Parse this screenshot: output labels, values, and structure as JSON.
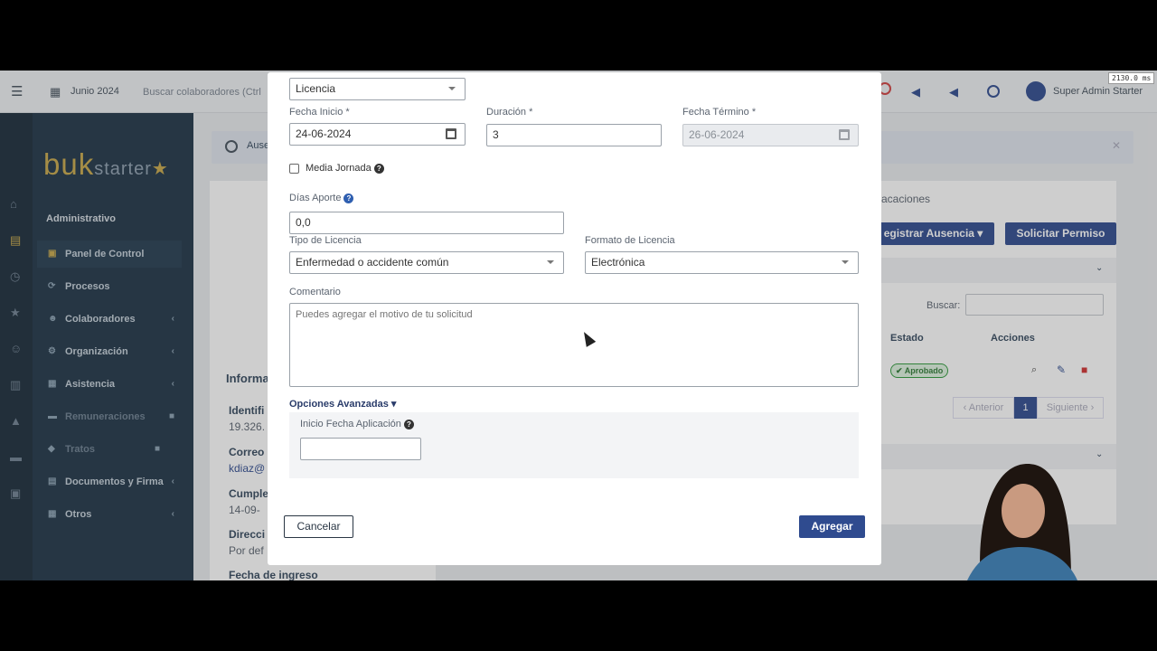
{
  "topbar": {
    "month": "Junio 2024",
    "search_placeholder": "Buscar colaboradores (Ctrl",
    "user": "Super Admin Starter",
    "timing": "2130.0 ms"
  },
  "sidebar": {
    "logo_main": "buk",
    "logo_sub": "starter",
    "section": "Administrativo",
    "items": [
      {
        "label": "Panel de Control"
      },
      {
        "label": "Procesos"
      },
      {
        "label": "Colaboradores"
      },
      {
        "label": "Organización"
      },
      {
        "label": "Asistencia"
      },
      {
        "label": "Remuneraciones"
      },
      {
        "label": "Tratos"
      },
      {
        "label": "Documentos y Firma"
      },
      {
        "label": "Otros"
      }
    ]
  },
  "background": {
    "alert_text": "Ause",
    "tab_label": "acaciones",
    "register_absence": "egistrar Ausencia",
    "request_permit": "Solicitar Permiso",
    "search_label": "Buscar:",
    "col_estado": "Estado",
    "col_acciones": "Acciones",
    "status_badge": "Aprobado",
    "prev": "Anterior",
    "page": "1",
    "next": "Siguiente",
    "info_title": "Informa",
    "ident_label": "Identifi",
    "ident_value": "19.326.",
    "email_label": "Correo",
    "email_value": "kdiaz@",
    "birthday_label": "Cumple",
    "birthday_value": "14-09-",
    "address_label": "Direcci",
    "address_value": "Por def",
    "start_date_label": "Fecha de ingreso"
  },
  "modal": {
    "type_value": "Licencia",
    "start_label": "Fecha Inicio *",
    "start_value": "24-06-2024",
    "duration_label": "Duración *",
    "duration_value": "3",
    "end_label": "Fecha Término *",
    "end_value": "26-06-2024",
    "half_day_label": "Media Jornada",
    "contribution_label": "Días Aporte",
    "contribution_value": "0,0",
    "license_type_label": "Tipo de Licencia",
    "license_type_value": "Enfermedad o accidente común",
    "license_format_label": "Formato de Licencia",
    "license_format_value": "Electrónica",
    "comment_label": "Comentario",
    "comment_placeholder": "Puedes agregar el motivo de tu solicitud",
    "advanced_label": "Opciones Avanzadas ▾",
    "apply_date_label": "Inicio Fecha Aplicación",
    "cancel_label": "Cancelar",
    "add_label": "Agregar"
  },
  "colors": {
    "primary": "#2f4b8f",
    "sidebar": "#1f3547",
    "success": "#2e9a3a"
  }
}
